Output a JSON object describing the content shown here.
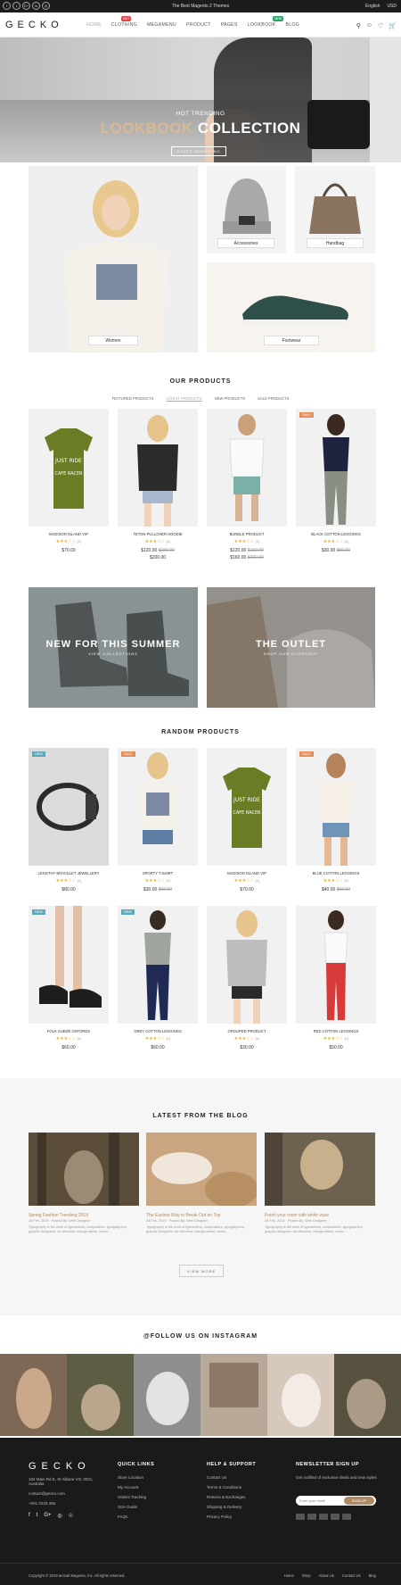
{
  "topbar": {
    "promo": "The Best Magento 2 Themes",
    "language": "English",
    "currency": "USD",
    "social": [
      "f",
      "t",
      "G+",
      "in",
      "◎"
    ]
  },
  "header": {
    "logo": "GECKO",
    "nav": [
      "HOME",
      "CLOTHING",
      "MEGAMENU",
      "PRODUCT",
      "PAGES",
      "LOOKBOOK",
      "BLOG"
    ],
    "badge_hot": "HOT",
    "badge_new": "NEW",
    "cart_count": "0"
  },
  "hero": {
    "subtitle": "HOT TRENDING",
    "title_a": "LOOKBOOK",
    "title_b": "COLLECTION",
    "button": "START SHOPPING"
  },
  "categories": [
    {
      "label": "Women"
    },
    {
      "label": "Accessories"
    },
    {
      "label": "Handbag"
    },
    {
      "label": "Footwear"
    }
  ],
  "our_products": {
    "heading": "OUR PRODUCTS",
    "tabs": [
      "FEATURED PRODUCTS",
      "LATEST PRODUCTS",
      "NEW PRODUCTS",
      "SALE PRODUCTS"
    ],
    "items": [
      {
        "name": "MADISON ISLAND VIP",
        "stars": "★★★☆☆",
        "count": "(1)",
        "price": "$70.00",
        "old": "",
        "price2": "",
        "badge": ""
      },
      {
        "name": "TETON PULLOVER HOODIE",
        "stars": "★★★☆☆",
        "count": "(1)",
        "price": "$120.00",
        "old": "$150.00",
        "price2": "$200.00",
        "badge": ""
      },
      {
        "name": "BUNDLE PRODUCT",
        "stars": "★★★☆☆",
        "count": "(1)",
        "price": "$120.00",
        "old": "$160.00",
        "price2": "$160.00",
        "old2": "$200.00",
        "badge": ""
      },
      {
        "name": "BLACK COTTON LEGGINGS",
        "stars": "★★★☆☆",
        "count": "(1)",
        "price": "$30.00",
        "old": "$50.00",
        "price2": "",
        "badge": "SALE"
      }
    ]
  },
  "promos": [
    {
      "title": "NEW FOR THIS SUMMER",
      "sub": "VIEW COLLECTIONS"
    },
    {
      "title": "THE OUTLET",
      "sub": "SHOP OUR CLOSEOUT"
    }
  ],
  "random_products": {
    "heading": "RANDOM PRODUCTS",
    "items": [
      {
        "name": "LENGTHY BRACELET JEWELLERY",
        "stars": "★★★☆☆",
        "count": "(1)",
        "price": "$80.00",
        "old": "",
        "badge": "NEW"
      },
      {
        "name": "SPORTY T-SHIRT",
        "stars": "★★★☆☆",
        "count": "(1)",
        "price": "$30.00",
        "old": "$60.00",
        "badge": "SALE"
      },
      {
        "name": "MADISON ISLAND VIP",
        "stars": "★★★☆☆",
        "count": "(1)",
        "price": "$70.00",
        "old": "",
        "badge": ""
      },
      {
        "name": "BLUE COTTON LEGGINGS",
        "stars": "★★★☆☆",
        "count": "(1)",
        "price": "$40.00",
        "old": "$50.00",
        "badge": "SALE"
      },
      {
        "name": "FOLK SUEDE OXFORDS",
        "stars": "★★★☆☆",
        "count": "(1)",
        "price": "$60.00",
        "old": "",
        "badge": "NEW"
      },
      {
        "name": "GREY COTTON LEGGINGS",
        "stars": "★★★☆☆",
        "count": "(1)",
        "price": "$60.00",
        "old": "",
        "badge": "NEW"
      },
      {
        "name": "GROUPED PRODUCT",
        "stars": "★★★☆☆",
        "count": "(1)",
        "price": "$30.00",
        "old": "",
        "badge": ""
      },
      {
        "name": "RED COTTON LEGGINGS",
        "stars": "★★★☆☆",
        "count": "(1)",
        "price": "$50.00",
        "old": "",
        "badge": ""
      }
    ]
  },
  "blog": {
    "heading": "LATEST FROM THE BLOG",
    "view_more": "VIEW MORE",
    "posts": [
      {
        "title": "Spring Fashion Trending 2019",
        "meta": "28 Feb, 2019  ·  Posted By: Web Designer",
        "excerpt": "Typography is the work of typesetters, compositors, typographers, graphic designers, art directors, manga artists, comic..."
      },
      {
        "title": "The Easiest Way to Break Out on Top",
        "meta": "28 Feb, 2019  ·  Posted By: Web Designer",
        "excerpt": "Typography is the work of typesetters, compositors, typographers, graphic designers, art directors, manga artists, comic..."
      },
      {
        "title": "Fresh your room with white vase",
        "meta": "28 Feb, 2019  ·  Posted By: Web Designer",
        "excerpt": "Typography is the work of typesetters, compositors, typographers, graphic designers, art directors, manga artists, comic..."
      }
    ]
  },
  "instagram": {
    "heading": "@FOLLOW US ON INSTAGRAM"
  },
  "footer": {
    "logo": "GECKO",
    "address": "184 Main Rd E, St Albans VIC 3021, Australia",
    "email": "contact@gecko.com",
    "phone": "+001 2233 456",
    "quick_links": {
      "heading": "QUICK LINKS",
      "items": [
        "Store Location",
        "My Account",
        "Orders Tracking",
        "Size Guide",
        "FAQs"
      ]
    },
    "help": {
      "heading": "HELP & SUPPORT",
      "items": [
        "Contact Us",
        "Terms & Conditions",
        "Returns & Exchanges",
        "Shipping & Delivery",
        "Privacy Policy"
      ]
    },
    "newsletter": {
      "heading": "NEWSLETTER SIGN UP",
      "text": "Get notified of exclusive deals and new styles",
      "placeholder": "Enter your email",
      "button": "SIGN UP"
    },
    "copyright": "Copyright © 2019 arrowit Magento, Inc. All rights reserved.",
    "bottom_links": [
      "Home",
      "Shop",
      "About Us",
      "Contact Us",
      "Blog"
    ]
  }
}
